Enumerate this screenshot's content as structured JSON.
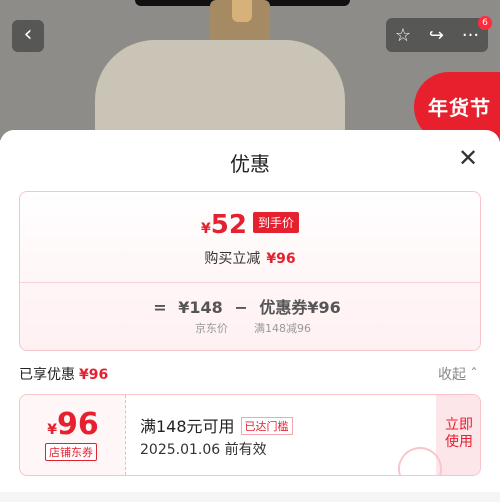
{
  "topbar": {
    "back_icon": "chevron-left-icon",
    "star_icon": "star-outline-icon",
    "share_icon": "share-icon",
    "more_icon": "more-dots-icon",
    "notification_count": "6"
  },
  "banner": {
    "festival_text": "年货节"
  },
  "sheet": {
    "title": "优惠",
    "close_icon": "close-icon",
    "price_box": {
      "currency": "¥",
      "final_price": "52",
      "final_tag": "到手价",
      "reduce_label": "购买立减",
      "reduce_value": "¥96",
      "formula": {
        "equals": "=",
        "jd_price": "¥148",
        "minus": "−",
        "coupon": "优惠券¥96"
      },
      "jd_price_label": "京东价",
      "coupon_rule_label": "满148减96"
    },
    "enjoyed": {
      "label": "已享优惠",
      "value": "¥96",
      "collapse_label": "收起"
    },
    "coupon_card": {
      "currency": "¥",
      "amount": "96",
      "type_label": "店铺东券",
      "condition": "满148元可用",
      "threshold_tag": "已达门槛",
      "expiry": "2025.01.06 前有效",
      "action_line1": "立即",
      "action_line2": "使用"
    }
  },
  "colors": {
    "accent": "#e5202f",
    "border": "#f6c4c9"
  }
}
